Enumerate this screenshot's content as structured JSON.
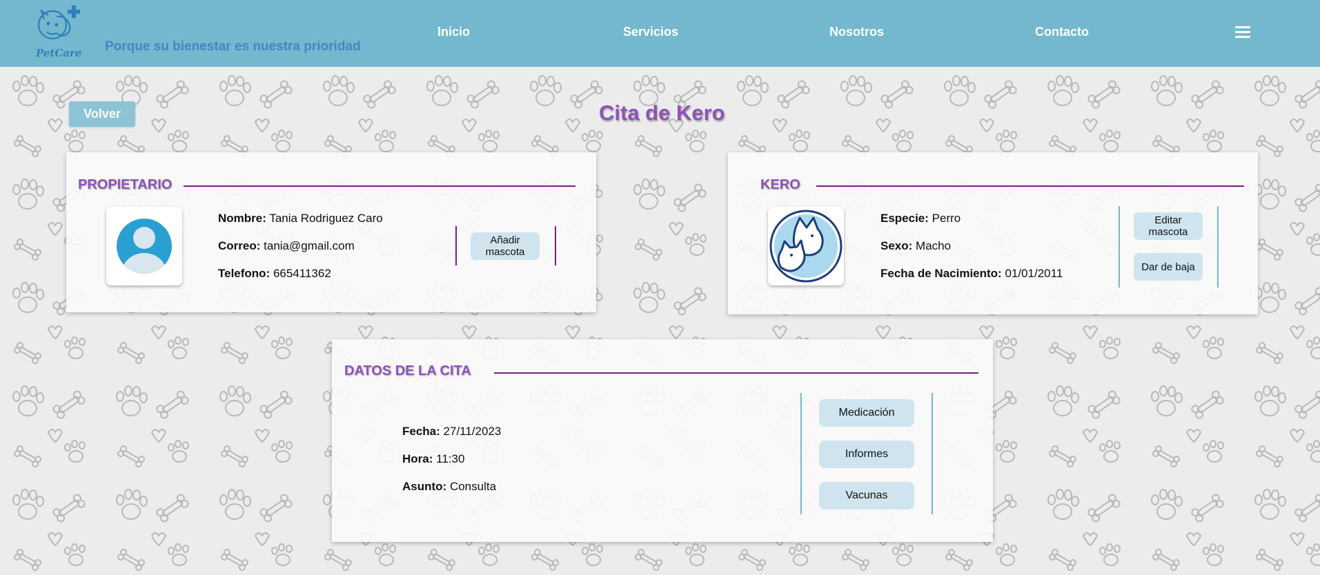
{
  "header": {
    "logo_text": "PetCare",
    "tagline": "Porque su bienestar es nuestra prioridad",
    "nav": [
      {
        "label": "Inicio"
      },
      {
        "label": "Servicios"
      },
      {
        "label": "Nosotros"
      },
      {
        "label": "Contacto"
      }
    ],
    "colors": {
      "bar": "#74b8cf",
      "tagline": "#3e88c2"
    }
  },
  "page": {
    "back_label": "Volver",
    "title": "Cita de Kero",
    "accent": "#8e52b8"
  },
  "owner": {
    "section_title": "PROPIETARIO",
    "name_label": "Nombre:",
    "name": "Tania Rodriguez Caro",
    "email_label": "Correo:",
    "email": "tania@gmail.com",
    "phone_label": "Telefono:",
    "phone": "665411362",
    "add_pet_label": "Añadir mascota",
    "avatar_icon": "user-avatar-icon"
  },
  "pet": {
    "section_title": "KERO",
    "species_label": "Especie:",
    "species": "Perro",
    "sex_label": "Sexo:",
    "sex": "Macho",
    "birth_label": "Fecha de Nacimiento:",
    "birth": "01/01/2011",
    "edit_label": "Editar mascota",
    "remove_label": "Dar de baja",
    "avatar_icon": "dog-cat-icon"
  },
  "appointment": {
    "section_title": "DATOS DE LA CITA",
    "date_label": "Fecha:",
    "date": "27/11/2023",
    "time_label": "Hora:",
    "time": "11:30",
    "subject_label": "Asunto:",
    "subject": "Consulta",
    "buttons": [
      {
        "label": "Medicación"
      },
      {
        "label": "Informes"
      },
      {
        "label": "Vacunas"
      }
    ]
  }
}
